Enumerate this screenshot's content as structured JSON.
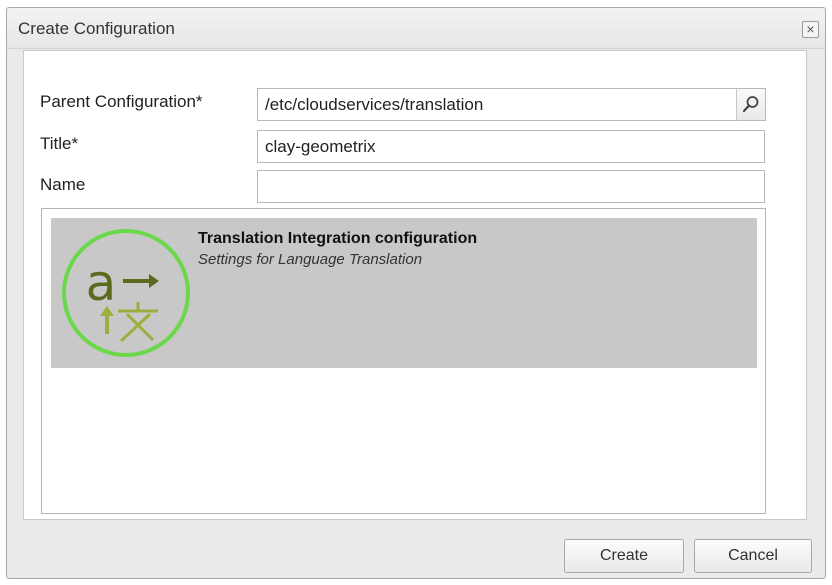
{
  "dialog": {
    "title": "Create Configuration",
    "close_label": "×"
  },
  "form": {
    "parent_config": {
      "label": "Parent Configuration*",
      "value": "/etc/cloudservices/translation"
    },
    "title": {
      "label": "Title*",
      "value": "clay-geometrix"
    },
    "name": {
      "label": "Name",
      "value": ""
    }
  },
  "templates": [
    {
      "title": "Translation Integration configuration",
      "description": "Settings for Language Translation",
      "icon": "translation-icon",
      "selected": true
    }
  ],
  "buttons": {
    "create": "Create",
    "cancel": "Cancel"
  },
  "colors": {
    "icon_ring": "#6bd84a",
    "icon_glyph": "#5a6b1e",
    "icon_glyph_light": "#9bae3e",
    "selection_bg": "#c8c8c8"
  }
}
